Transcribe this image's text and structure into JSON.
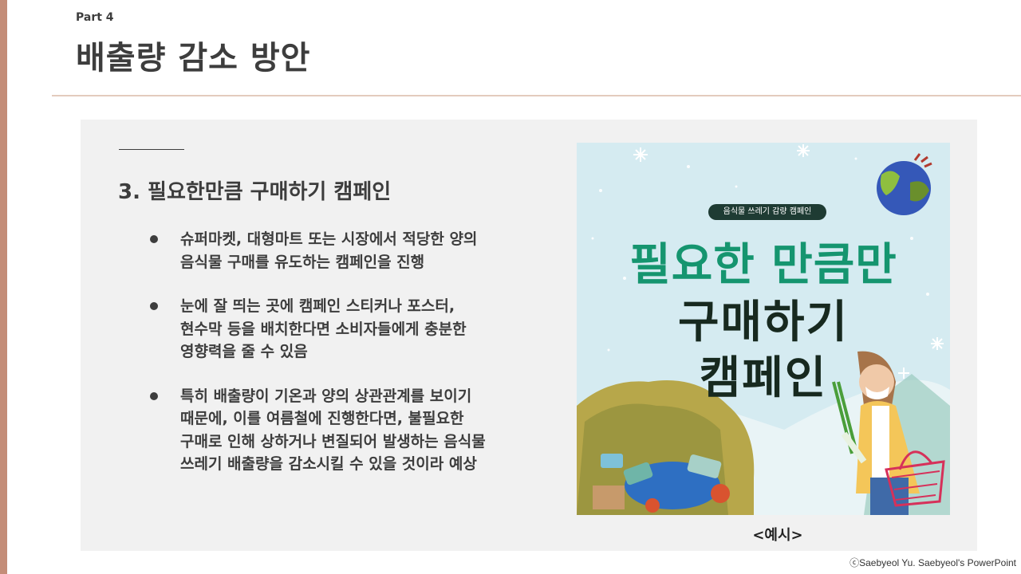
{
  "slide": {
    "part": "Part 4",
    "title": "배출량 감소 방안",
    "section_title": "3. 필요한만큼 구매하기 캠페인",
    "bullets": [
      {
        "lines": [
          "슈퍼마켓, 대형마트 또는 시장에서 적당한 양의",
          "음식물 구매를 유도하는 캠페인을 진행"
        ]
      },
      {
        "lines": [
          "눈에 잘 띄는 곳에 캠페인 스티커나 포스터,",
          "현수막 등을 배치한다면 소비자들에게 충분한",
          "영향력을 줄 수 있음"
        ]
      },
      {
        "lines": [
          "특히 배출량이 기온과 양의 상관관계를 보이기",
          "때문에, 이를 여름철에 진행한다면, 불필요한",
          "구매로 인해 상하거나 변질되어 발생하는 음식물",
          "쓰레기 배출량을 감소시킬 수 있을 것이라 예상"
        ]
      }
    ],
    "caption": "<예시>",
    "copyright": "ⓒSaebyeol Yu. Saebyeol's PowerPoint"
  },
  "poster": {
    "badge": "음식물 쓰레기 감량 캠페인",
    "line1": "필요한 만큼만",
    "line2": "구매하기",
    "line3": "캠페인",
    "colors": {
      "background": "#d5ebf1",
      "accent": "#15956f",
      "dark": "#17291f"
    }
  },
  "icons": [
    "earth-icon",
    "snowflake-icon",
    "food-waste-pile-illustration",
    "woman-shopper-illustration",
    "shopping-basket-icon"
  ]
}
